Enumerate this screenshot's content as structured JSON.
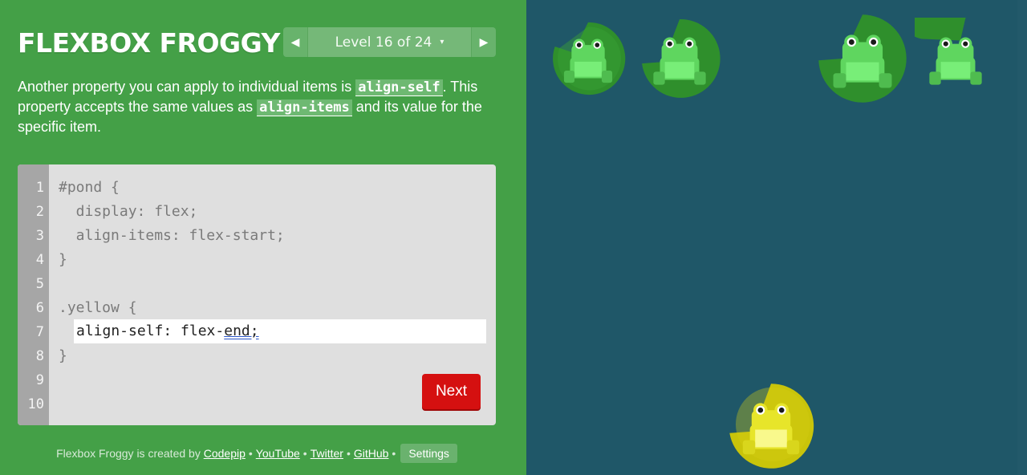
{
  "app": {
    "title": "FLEXBOX FROGGY"
  },
  "level_nav": {
    "prev_icon": "triangle-left",
    "label": "Level 16 of 24",
    "caret": "▾",
    "next_icon": "triangle-right"
  },
  "instructions": {
    "part1": "Another property you can apply to individual items is ",
    "code1": "align-self",
    "part2": ". This property accepts the same values as ",
    "code2": "align-items",
    "part3": " and its value for the specific item."
  },
  "editor": {
    "line_numbers": [
      "1",
      "2",
      "3",
      "4",
      "5",
      "6",
      "7",
      "8",
      "9",
      "10"
    ],
    "lines": [
      "#pond {",
      "  display: flex;",
      "  align-items: flex-start;",
      "}",
      "",
      ".yellow {",
      "",
      "}"
    ],
    "input_prefix": "align-self: flex-",
    "input_underlined": "end;",
    "next_label": "Next"
  },
  "footer": {
    "prefix": "Flexbox Froggy is created by ",
    "links": [
      "Codepip",
      "YouTube",
      "Twitter",
      "GitHub"
    ],
    "separator": "•",
    "settings_label": "Settings"
  },
  "pond": {
    "frogs": [
      {
        "color": "green"
      },
      {
        "color": "green"
      },
      {
        "color": "green"
      },
      {
        "color": "green"
      },
      {
        "color": "yellow"
      }
    ],
    "colors": {
      "pond": "#1f5768",
      "green_pad": "#2f8f2c",
      "yellow_pad": "#c9c40a"
    }
  }
}
